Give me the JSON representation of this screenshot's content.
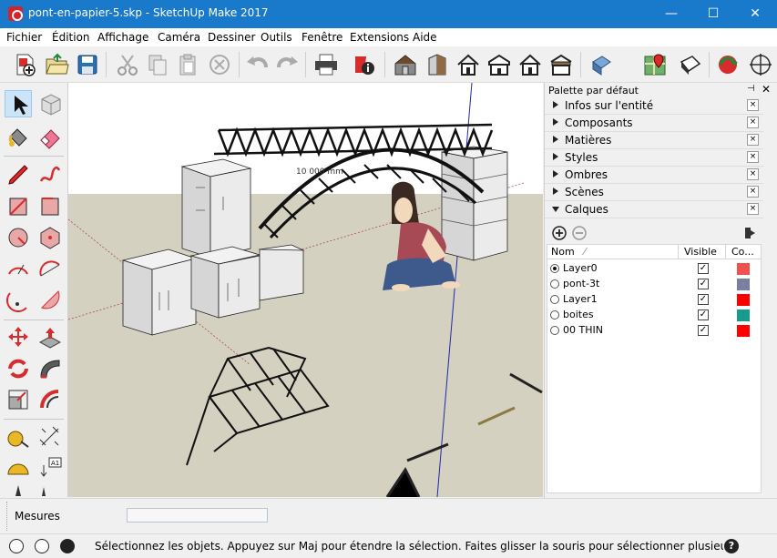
{
  "window": {
    "title": "pont-en-papier-5.skp - SketchUp Make 2017",
    "minimize": "—",
    "maximize": "☐",
    "close": "✕"
  },
  "menu": [
    "Fichier",
    "Édition",
    "Affichage",
    "Caméra",
    "Dessiner",
    "Outils",
    "Fenêtre",
    "Extensions",
    "Aide"
  ],
  "toolbar": {
    "icons": [
      "new-file-icon",
      "open-folder-icon",
      "save-icon",
      "cut-icon",
      "copy-icon",
      "paste-icon",
      "erase-icon",
      "undo-icon",
      "redo-icon",
      "print-icon",
      "model-info-icon",
      "warehouse-icon",
      "building-front-icon",
      "house-top-icon",
      "house-left-icon",
      "house-right-icon",
      "house-back-icon",
      "section-plane-icon",
      "map-location-icon",
      "share-model-icon",
      "ruby-extension-icon",
      "orbit-icon"
    ]
  },
  "lefttools": {
    "icons": [
      "select-arrow-icon",
      "make-component-icon",
      "paint-bucket-icon",
      "eraser-icon",
      "pencil-line-icon",
      "freehand-icon",
      "rectangle-icon",
      "rotated-rectangle-icon",
      "circle-icon",
      "polygon-icon",
      "arc-icon",
      "two-point-arc-icon",
      "three-point-arc-icon",
      "pie-icon",
      "move-icon",
      "push-pull-icon",
      "rotate-icon",
      "follow-me-icon",
      "scale-icon",
      "offset-icon",
      "tape-measure-icon",
      "dimension-icon",
      "protractor-icon",
      "text-icon",
      "axes-icon",
      "3d-text-icon"
    ]
  },
  "viewport": {
    "sky": "#ffffff",
    "ground": "#d5d1c0",
    "dimension_label": "10 000 mm"
  },
  "tray": {
    "title": "Palette par défaut",
    "pin": "⊣",
    "close": "✕",
    "panels": [
      {
        "label": "Infos sur l'entité",
        "open": false
      },
      {
        "label": "Composants",
        "open": false
      },
      {
        "label": "Matières",
        "open": false
      },
      {
        "label": "Styles",
        "open": false
      },
      {
        "label": "Ombres",
        "open": false
      },
      {
        "label": "Scènes",
        "open": false
      },
      {
        "label": "Calques",
        "open": true
      }
    ],
    "panel_close": "×",
    "layers": {
      "columns": {
        "name": "Nom",
        "visible": "Visible",
        "color": "Co..."
      },
      "rows": [
        {
          "name": "Layer0",
          "active": true,
          "visible": true,
          "color": "#ef5050"
        },
        {
          "name": "pont-3t",
          "active": false,
          "visible": true,
          "color": "#7b7fa2"
        },
        {
          "name": "Layer1",
          "active": false,
          "visible": true,
          "color": "#ff0000"
        },
        {
          "name": "boites",
          "active": false,
          "visible": true,
          "color": "#1a9a8a"
        },
        {
          "name": "00 THIN",
          "active": false,
          "visible": true,
          "color": "#ff0000"
        }
      ],
      "check": "✓"
    }
  },
  "measures": {
    "label": "Mesures",
    "value": ""
  },
  "status": {
    "text": "Sélectionnez les objets. Appuyez sur Maj pour étendre la sélection. Faites glisser la souris pour sélectionner plusieurs obj...",
    "help": "?"
  }
}
